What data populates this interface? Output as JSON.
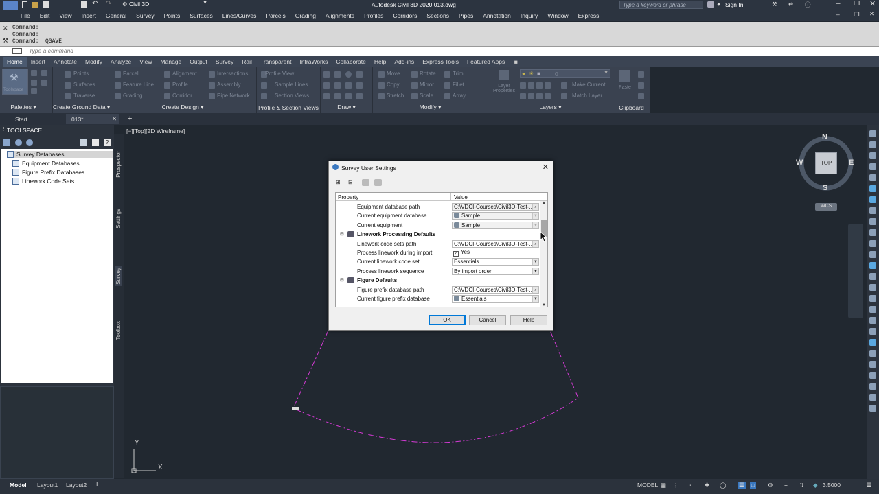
{
  "app": {
    "title": "Autodesk Civil 3D 2020   013.dwg",
    "workspace": "Civil 3D",
    "search_placeholder": "Type a keyword or phrase",
    "sign_in": "Sign In"
  },
  "menu": [
    "File",
    "Edit",
    "View",
    "Insert",
    "General",
    "Survey",
    "Points",
    "Surfaces",
    "Lines/Curves",
    "Parcels",
    "Grading",
    "Alignments",
    "Profiles",
    "Corridors",
    "Sections",
    "Pipes",
    "Annotation",
    "Inquiry",
    "Window",
    "Express"
  ],
  "command": {
    "history": [
      "Command:",
      "Command:",
      "Command:  _QSAVE"
    ],
    "placeholder": "Type a command"
  },
  "ribbon": {
    "tabs": [
      "Home",
      "Insert",
      "Annotate",
      "Modify",
      "Analyze",
      "View",
      "Manage",
      "Output",
      "Survey",
      "Rail",
      "Transparent",
      "InfraWorks",
      "Collaborate",
      "Help",
      "Add-ins",
      "Express Tools",
      "Featured Apps"
    ],
    "active_tab": "Home",
    "toolspace_btn": "Toolspace",
    "panels": {
      "palettes": "Palettes",
      "ground": "Create Ground Data",
      "design": "Create Design",
      "profile": "Profile & Section Views",
      "draw": "Draw",
      "modify": "Modify",
      "layers": "Layers",
      "clipboard": "Clipboard"
    },
    "items": {
      "points": "Points",
      "surfaces": "Surfaces",
      "traverse": "Traverse",
      "parcel": "Parcel",
      "feature_line": "Feature Line",
      "grading": "Grading",
      "alignment": "Alignment",
      "profile": "Profile",
      "corridor": "Corridor",
      "intersections": "Intersections",
      "assembly": "Assembly",
      "pipe_network": "Pipe Network",
      "profile_view": "Profile View",
      "sample_lines": "Sample Lines",
      "section_views": "Section Views",
      "move": "Move",
      "rotate": "Rotate",
      "trim": "Trim",
      "copy": "Copy",
      "mirror": "Mirror",
      "fillet": "Fillet",
      "stretch": "Stretch",
      "scale": "Scale",
      "array": "Array",
      "layer_properties": "Layer Properties",
      "make_current": "Make Current",
      "match_layer": "Match Layer",
      "paste": "Paste",
      "layer_value": "0"
    }
  },
  "doc_tabs": [
    "Start",
    "013*"
  ],
  "toolspace": {
    "title": "TOOLSPACE",
    "tree": [
      "Survey Databases",
      "Equipment Databases",
      "Figure Prefix Databases",
      "Linework Code Sets"
    ],
    "selected": "Survey Databases",
    "vtabs": [
      "Prospector",
      "Settings",
      "Survey",
      "Toolbox"
    ]
  },
  "viewport": {
    "label": "[−][Top][2D Wireframe]",
    "cube": {
      "n": "N",
      "s": "S",
      "e": "E",
      "w": "W",
      "face": "TOP",
      "wcs": "WCS"
    },
    "ucs": {
      "x": "X",
      "y": "Y"
    }
  },
  "dialog": {
    "title": "Survey User Settings",
    "col_property": "Property",
    "col_value": "Value",
    "rows": [
      {
        "type": "prop",
        "name": "Equipment database path",
        "value": "C:\\VDCI-Courses\\Civil3D-Test-...",
        "ctrl": "browse"
      },
      {
        "type": "prop",
        "name": "Current equipment database",
        "value": "Sample",
        "ctrl": "disabled-icon"
      },
      {
        "type": "prop",
        "name": "Current equipment",
        "value": "Sample",
        "ctrl": "disabled-icon"
      },
      {
        "type": "cat",
        "name": "Linework Processing Defaults",
        "value": ""
      },
      {
        "type": "prop",
        "name": "Linework code sets path",
        "value": "C:\\VDCI-Courses\\Civil3D-Test-...",
        "ctrl": "browse"
      },
      {
        "type": "prop",
        "name": "Process linework during import",
        "value": "Yes",
        "ctrl": "check"
      },
      {
        "type": "prop",
        "name": "Current linework code set",
        "value": "Essentials",
        "ctrl": "dropdown"
      },
      {
        "type": "prop",
        "name": "Process linework sequence",
        "value": "By import order",
        "ctrl": "dropdown"
      },
      {
        "type": "cat",
        "name": "Figure Defaults",
        "value": ""
      },
      {
        "type": "prop",
        "name": "Figure prefix database path",
        "value": "C:\\VDCI-Courses\\Civil3D-Test-...",
        "ctrl": "browse"
      },
      {
        "type": "prop",
        "name": "Current figure prefix database",
        "value": "Essentials",
        "ctrl": "dropdown-icon"
      }
    ],
    "buttons": {
      "ok": "OK",
      "cancel": "Cancel",
      "help": "Help"
    }
  },
  "status": {
    "tabs": [
      "Model",
      "Layout1",
      "Layout2"
    ],
    "model": "MODEL",
    "scale": "3.5000"
  },
  "colors": {
    "drawing_bg": "#212830",
    "polyline": "#d63ad6",
    "accent": "#0078d7"
  }
}
